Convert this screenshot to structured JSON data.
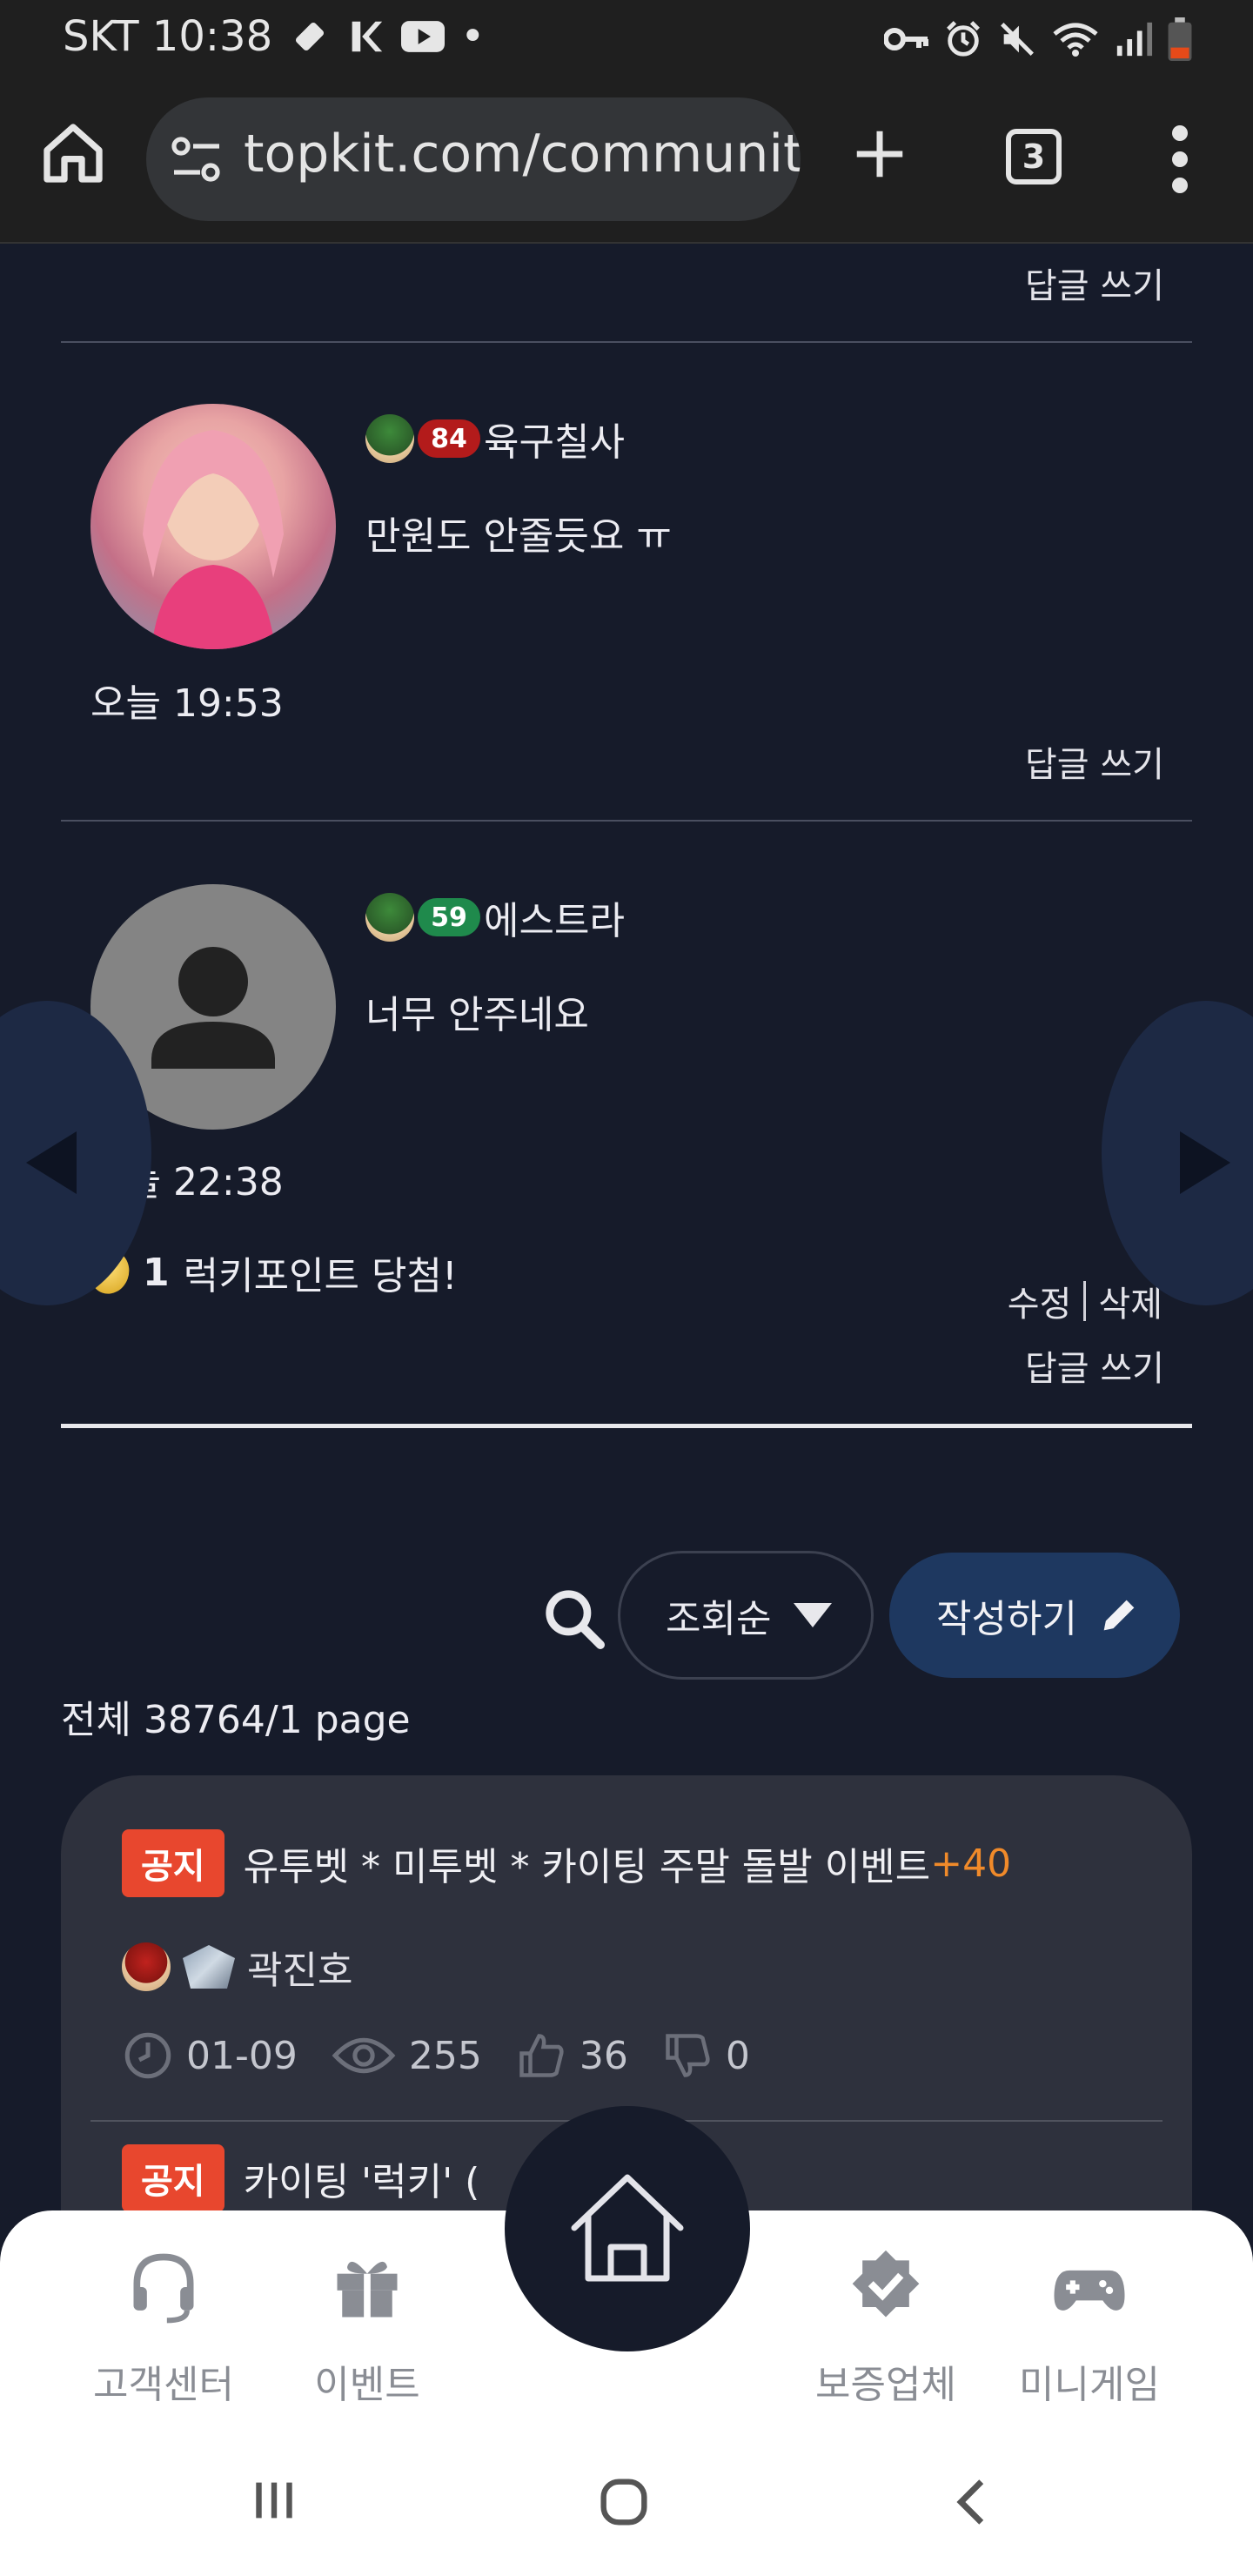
{
  "status_bar": {
    "carrier_time": "SKT 10:38",
    "dot": "•"
  },
  "browser": {
    "url": "topkit.com/community",
    "tab_count": "3"
  },
  "comments": {
    "top_reply_label": "답글 쓰기",
    "items": [
      {
        "username": "육구칠사",
        "level": "84",
        "text": "만원도 안줄듯요 ㅠ",
        "time": "오늘 19:53",
        "reply_label": "답글 쓰기"
      },
      {
        "username": "에스트라",
        "level": "59",
        "text": "너무 안주네요",
        "time": "오늘 22:38",
        "lucky_count": "1",
        "lucky_text": "럭키포인트 당첨!",
        "edit_label": "수정",
        "delete_label": "삭제",
        "reply_label": "답글 쓰기"
      }
    ]
  },
  "controls": {
    "sort_label": "조회순",
    "write_label": "작성하기",
    "total_text": "전체 38764/1 page"
  },
  "posts": [
    {
      "badge": "공지",
      "title": "유투벳 * 미투벳 * 카이팅 주말 돌발 이벤트",
      "comment_count": "+40",
      "author": "곽진호",
      "date": "01-09",
      "views": "255",
      "likes": "36",
      "dislikes": "0"
    },
    {
      "badge": "공지",
      "title": "카이팅 '럭키' ("
    }
  ],
  "bottom_nav": {
    "items": [
      {
        "label": "고객센터",
        "icon": "headset-icon"
      },
      {
        "label": "이벤트",
        "icon": "gift-icon"
      },
      {
        "label": "보증업체",
        "icon": "verified-badge-icon"
      },
      {
        "label": "미니게임",
        "icon": "gamepad-icon"
      }
    ]
  },
  "colors": {
    "background": "#161b2a",
    "notice_badge": "#e8472e",
    "comment_count": "#f08a2a",
    "write_button": "#1e3860"
  }
}
